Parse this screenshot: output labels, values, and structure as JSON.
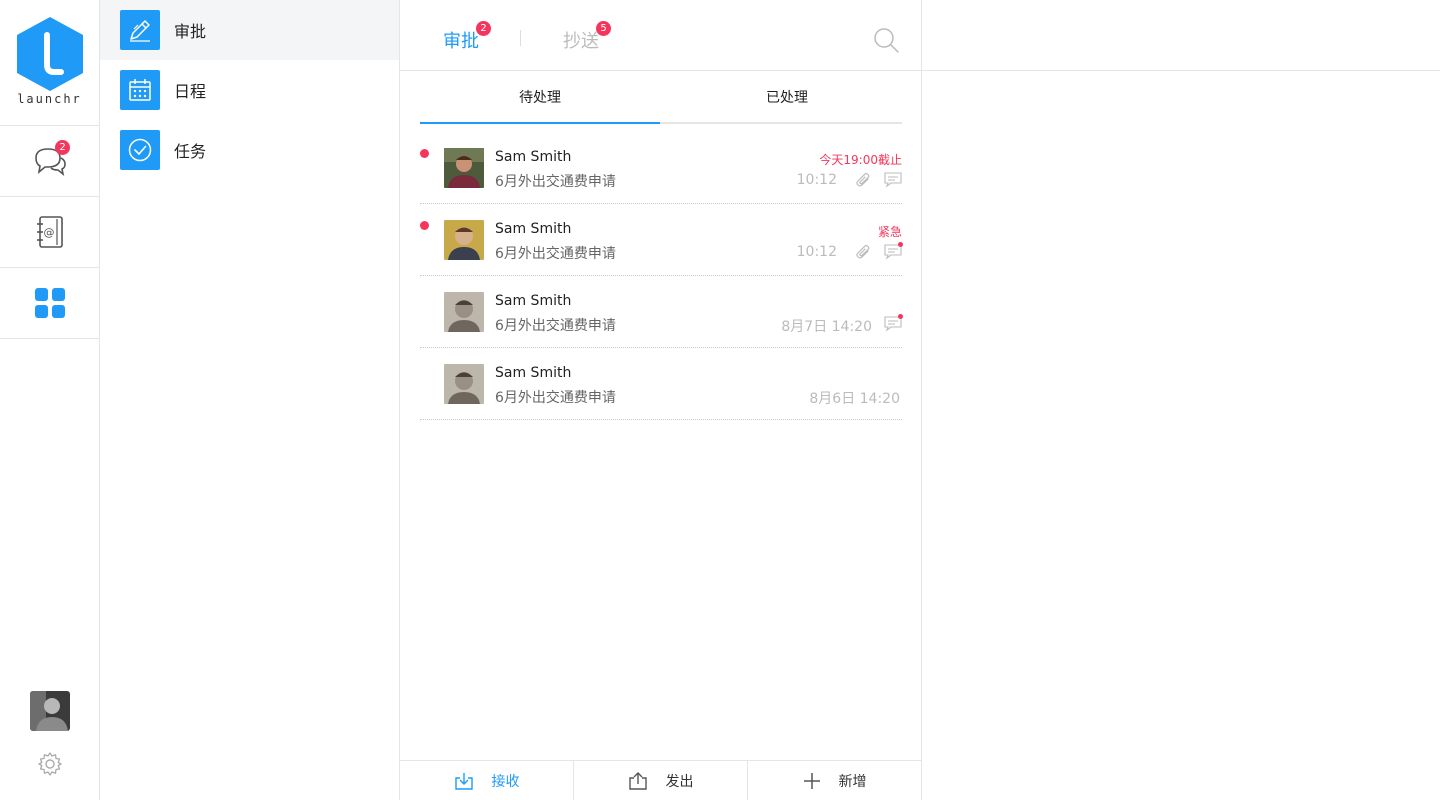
{
  "brand": {
    "name": "launchr",
    "color": "#1f9af6"
  },
  "rail": {
    "chat_badge": "2",
    "items": [
      {
        "icon": "chat-icon"
      },
      {
        "icon": "address-book-icon"
      },
      {
        "icon": "apps-grid-icon"
      }
    ]
  },
  "modules": [
    {
      "label": "审批",
      "icon": "pen-icon",
      "active": true
    },
    {
      "label": "日程",
      "icon": "calendar-icon",
      "active": false
    },
    {
      "label": "任务",
      "icon": "check-circle-icon",
      "active": false
    }
  ],
  "top_tabs": [
    {
      "label": "审批",
      "badge": "2",
      "active": true
    },
    {
      "label": "抄送",
      "badge": "5",
      "active": false
    }
  ],
  "sub_tabs": [
    {
      "label": "待处理",
      "active": true
    },
    {
      "label": "已处理",
      "active": false
    }
  ],
  "items": [
    {
      "name": "Sam Smith",
      "desc": "6月外出交通费申请",
      "flag": "今天19:00截止",
      "time": "10:12",
      "unread": true,
      "attachment": true,
      "comment": true,
      "comment_new": false
    },
    {
      "name": "Sam Smith",
      "desc": "6月外出交通费申请",
      "flag": "紧急",
      "time": "10:12",
      "unread": true,
      "attachment": true,
      "comment": true,
      "comment_new": true
    },
    {
      "name": "Sam Smith",
      "desc": "6月外出交通费申请",
      "flag": "",
      "time": "8月7日 14:20",
      "unread": false,
      "attachment": false,
      "comment": true,
      "comment_new": true
    },
    {
      "name": "Sam Smith",
      "desc": "6月外出交通费申请",
      "flag": "",
      "time": "8月6日 14:20",
      "unread": false,
      "attachment": false,
      "comment": false,
      "comment_new": false
    }
  ],
  "bottom_bar": [
    {
      "label": "接收",
      "icon": "inbox-download-icon",
      "active": true
    },
    {
      "label": "发出",
      "icon": "share-upload-icon",
      "active": false
    },
    {
      "label": "新增",
      "icon": "plus-icon",
      "active": false
    }
  ],
  "colors": {
    "accent": "#1f9af6",
    "alert": "#f5365c",
    "muted": "#bbbbbb"
  }
}
